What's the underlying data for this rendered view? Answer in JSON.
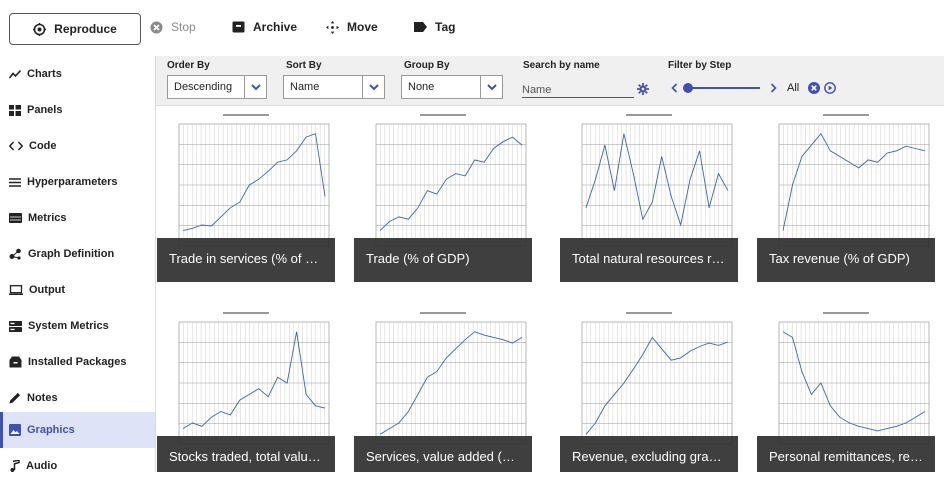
{
  "toolbar": {
    "reproduce_label": "Reproduce",
    "stop_label": "Stop",
    "archive_label": "Archive",
    "move_label": "Move",
    "tag_label": "Tag"
  },
  "sidebar": {
    "items": [
      {
        "label": "Charts",
        "icon": "line-chart-icon"
      },
      {
        "label": "Panels",
        "icon": "panels-icon"
      },
      {
        "label": "Code",
        "icon": "code-icon"
      },
      {
        "label": "Hyperparameters",
        "icon": "list-icon"
      },
      {
        "label": "Metrics",
        "icon": "table-icon"
      },
      {
        "label": "Graph Definition",
        "icon": "graph-icon"
      },
      {
        "label": "Output",
        "icon": "monitor-icon"
      },
      {
        "label": "System Metrics",
        "icon": "server-icon"
      },
      {
        "label": "Installed Packages",
        "icon": "package-icon"
      },
      {
        "label": "Notes",
        "icon": "pencil-icon"
      },
      {
        "label": "Graphics",
        "icon": "image-icon",
        "active": true
      },
      {
        "label": "Audio",
        "icon": "music-icon"
      }
    ]
  },
  "filters": {
    "order_by_label": "Order By",
    "order_by_value": "Descending",
    "sort_by_label": "Sort By",
    "sort_by_value": "Name",
    "group_by_label": "Group By",
    "group_by_value": "None",
    "search_label": "Search by name",
    "search_placeholder": "Name",
    "step_label": "Filter by Step",
    "step_all": "All",
    "accent_color": "#3f51b5"
  },
  "gallery": {
    "cards": [
      {
        "caption": "Trade in services (% of GDP)"
      },
      {
        "caption": "Trade (% of GDP)"
      },
      {
        "caption": "Total natural resources rents (% of GDP)"
      },
      {
        "caption": "Tax revenue (% of GDP)"
      },
      {
        "caption": "Stocks traded, total value (% of GDP)"
      },
      {
        "caption": "Services, value added (% of GDP)"
      },
      {
        "caption": "Revenue, excluding grants (% of GDP)"
      },
      {
        "caption": "Personal remittances, received (% of GDP)"
      }
    ]
  }
}
